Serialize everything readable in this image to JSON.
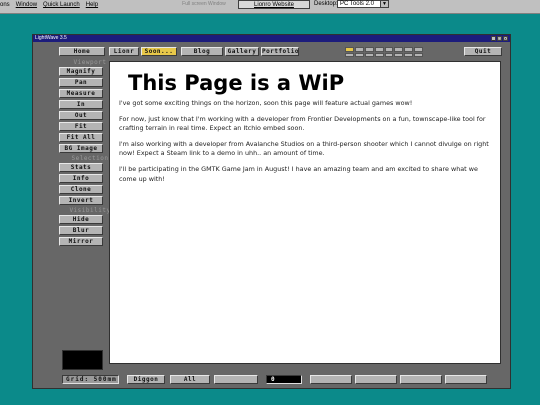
{
  "system": {
    "menu": [
      "ons",
      "Window",
      "Quick Launch",
      "Help"
    ],
    "fullscreen_label": "Full screen Window",
    "website_label": "Lionro Website",
    "desktop_label": "Desktop:",
    "desktop_value": "PC Tools 2.0"
  },
  "window": {
    "title": "LightWave 3.5",
    "controls": [
      "_",
      "□",
      "X"
    ]
  },
  "topnav": {
    "items": [
      "Home",
      "Lionr",
      "Soon...",
      "Blog",
      "Gallery",
      "Portfolio"
    ],
    "active": "Soon...",
    "quit_label": "Quit"
  },
  "sidebar": {
    "viewport_label": "Viewport",
    "viewport_buttons": [
      "Magnify",
      "Pan",
      "Measure",
      "In",
      "Out",
      "Fit",
      "Fit All",
      "BG Image"
    ],
    "selection_label": "Selection",
    "selection_buttons": [
      "Stats",
      "Info",
      "Clone",
      "Invert"
    ],
    "visibility_label": "Visibility",
    "visibility_buttons": [
      "Hide",
      "Blur",
      "Mirror"
    ]
  },
  "content": {
    "heading": "This Page is a WiP",
    "paragraphs": [
      "I've got some exciting things on the horizon, soon this page will feature actual games wow!",
      "For now, just know that I'm working with a developer from Frontier Developments on a fun, townscape-like tool for crafting terrain in real time. Expect an Itchio embed soon.",
      "I'm also working with a developer from Avalanche Studios on a third-person shooter which I cannot divulge on right now! Expect a Steam link to a demo in uhh.. an amount of time.",
      "I'll be participating in the GMTK Game Jam in August! I have an amazing team and am excited to share what we come up with!"
    ]
  },
  "statusbar": {
    "grid": "Grid: 500mm",
    "buttons": [
      "Diggon",
      "All"
    ],
    "value": "0"
  }
}
